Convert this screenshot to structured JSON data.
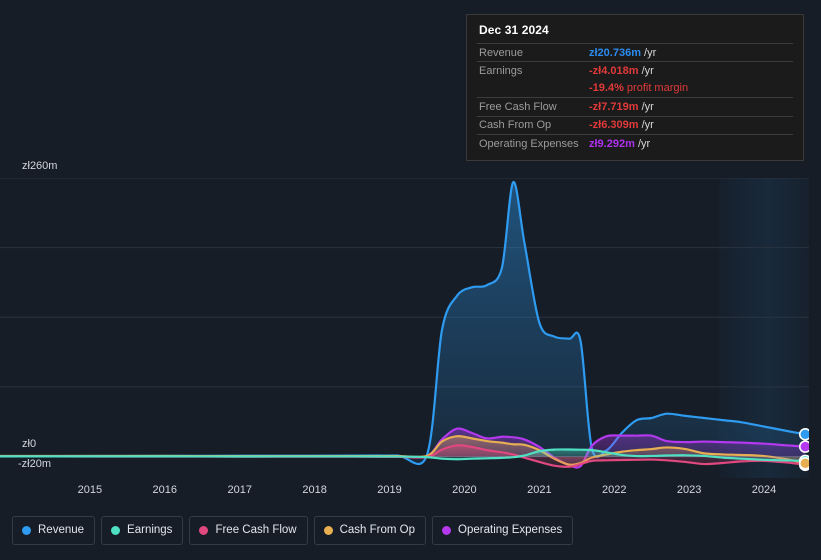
{
  "tooltip": {
    "title": "Dec 31 2024",
    "rows": [
      {
        "label": "Revenue",
        "value": "zł20.736m",
        "unit": "/yr",
        "color_key": "rev"
      },
      {
        "label": "Earnings",
        "value": "-zł4.018m",
        "unit": "/yr",
        "color_key": "neg"
      },
      {
        "label": "",
        "value": "-19.4%",
        "unit": "profit margin",
        "color_key": "neg"
      },
      {
        "label": "Free Cash Flow",
        "value": "-zł7.719m",
        "unit": "/yr",
        "color_key": "neg"
      },
      {
        "label": "Cash From Op",
        "value": "-zł6.309m",
        "unit": "/yr",
        "color_key": "neg"
      },
      {
        "label": "Operating Expenses",
        "value": "zł9.292m",
        "unit": "/yr",
        "color_key": "opex"
      }
    ]
  },
  "axis": {
    "y_top_label": "zł260m",
    "y_zero_label": "zł0",
    "y_neg_label": "-zł20m",
    "x_labels": [
      "2015",
      "2016",
      "2017",
      "2018",
      "2019",
      "2020",
      "2021",
      "2022",
      "2023",
      "2024"
    ]
  },
  "legend": [
    {
      "label": "Revenue",
      "color": "#2e9bf0"
    },
    {
      "label": "Earnings",
      "color": "#4fe0c4"
    },
    {
      "label": "Free Cash Flow",
      "color": "#e0487f"
    },
    {
      "label": "Cash From Op",
      "color": "#e8ae52"
    },
    {
      "label": "Operating Expenses",
      "color": "#b438ee"
    }
  ],
  "chart_data": {
    "type": "area",
    "title": "",
    "xlabel": "",
    "ylabel": "",
    "currency": "zł",
    "ylim": [
      -20,
      260
    ],
    "yticks": [
      260,
      0,
      -20
    ],
    "ytick_labels": [
      "zł260m",
      "zł0",
      "-zł20m"
    ],
    "grid": true,
    "legend_position": "bottom",
    "x_axis_labels": [
      "2015",
      "2016",
      "2017",
      "2018",
      "2019",
      "2020",
      "2021",
      "2022",
      "2023",
      "2024"
    ],
    "x_range": [
      2014.3,
      2025.1
    ],
    "forecast_shading_from": 2023.9,
    "x": [
      2014.3,
      2015,
      2016,
      2017,
      2018,
      2019,
      2019.6,
      2020.0,
      2020.2,
      2020.4,
      2020.6,
      2020.8,
      2021.0,
      2021.15,
      2021.3,
      2021.5,
      2021.7,
      2021.9,
      2022.05,
      2022.2,
      2022.4,
      2022.6,
      2022.8,
      2023.0,
      2023.2,
      2023.45,
      2023.7,
      2023.95,
      2024.2,
      2024.5,
      2024.8,
      2025.05
    ],
    "series": [
      {
        "name": "Revenue",
        "color": "#2e9bf0",
        "values": [
          0.4,
          0.5,
          0.6,
          0.7,
          0.8,
          0.9,
          1.0,
          1.5,
          118,
          150,
          158,
          160,
          176,
          256,
          200,
          125,
          112,
          110,
          108,
          8,
          6,
          22,
          34,
          36,
          40,
          38,
          36,
          34,
          32,
          28,
          24,
          20.736
        ]
      },
      {
        "name": "Earnings",
        "color": "#4fe0c4",
        "values": [
          0.2,
          0.2,
          0.2,
          0.1,
          0.1,
          0.1,
          0.0,
          -0.5,
          -2.0,
          -2.5,
          -2.0,
          -1.6,
          -1.2,
          -0.6,
          1.0,
          5.0,
          6.5,
          6.6,
          6.4,
          6.0,
          4.0,
          1.5,
          0.5,
          0.6,
          1.0,
          1.2,
          0.6,
          -1.0,
          -2.0,
          -3.0,
          -3.6,
          -4.018
        ]
      },
      {
        "name": "Free Cash Flow",
        "color": "#e0487f",
        "values": [
          0.1,
          0.1,
          0.0,
          0.0,
          -0.1,
          -0.1,
          -0.2,
          -0.5,
          6.5,
          10.5,
          9.0,
          6.0,
          4.0,
          2.0,
          -1.0,
          -5.0,
          -8.5,
          -9.5,
          -7.0,
          -4.0,
          -3.5,
          -3.2,
          -3.0,
          -2.8,
          -3.5,
          -5.0,
          -7.0,
          -6.0,
          -4.5,
          -4.0,
          -5.5,
          -7.719
        ]
      },
      {
        "name": "Cash From Op",
        "color": "#e8ae52",
        "values": [
          0.6,
          0.6,
          0.6,
          0.5,
          0.5,
          0.5,
          0.5,
          0.6,
          14.0,
          19.0,
          17.0,
          14.5,
          13.0,
          11.5,
          11.0,
          6.0,
          -2.0,
          -7.5,
          -6.0,
          -1.0,
          2.0,
          4.5,
          6.0,
          7.0,
          8.5,
          7.0,
          3.0,
          2.0,
          1.5,
          0.5,
          -2.5,
          -6.309
        ]
      },
      {
        "name": "Operating Expenses",
        "color": "#b438ee",
        "values": [
          0.3,
          0.3,
          0.3,
          0.3,
          0.3,
          0.3,
          0.3,
          0.5,
          16.0,
          26.0,
          22.0,
          17.0,
          18.5,
          18.0,
          16.0,
          9.0,
          -1.0,
          -8.0,
          -9.0,
          10.0,
          19.0,
          19.5,
          19.5,
          19.5,
          14.5,
          13.5,
          14.0,
          13.5,
          13.0,
          12.0,
          10.5,
          9.292
        ]
      }
    ]
  }
}
